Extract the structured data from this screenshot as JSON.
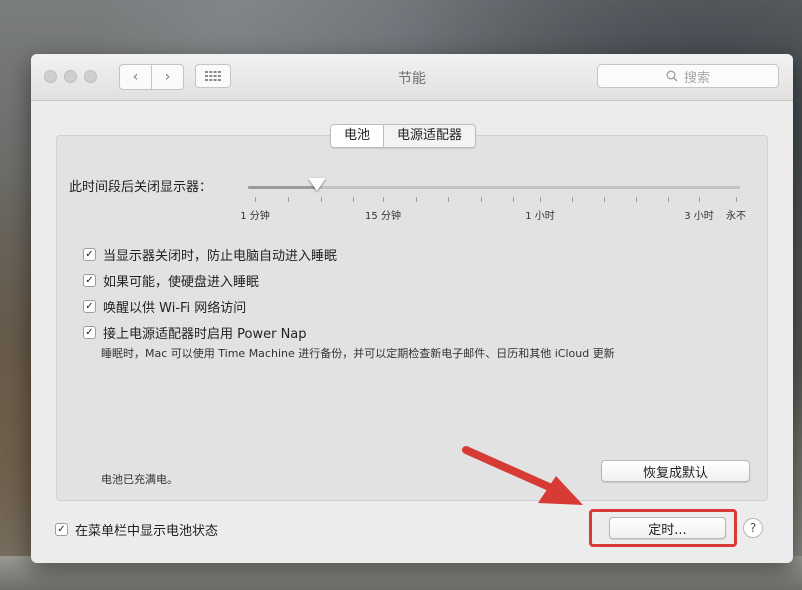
{
  "window": {
    "title": "节能"
  },
  "toolbar": {
    "back_glyph": "‹",
    "forward_glyph": "›",
    "search_placeholder": "搜索",
    "search_icon": "magnifier-icon"
  },
  "tabs": [
    {
      "label": "电池",
      "active": true
    },
    {
      "label": "电源适配器",
      "active": false
    }
  ],
  "display_sleep": {
    "label": "此时间段后关闭显示器：",
    "ticks": [
      "1 分钟",
      "15 分钟",
      "1 小时",
      "3 小时",
      "永不"
    ],
    "value": "2 分钟",
    "value_fraction": 0.14
  },
  "options": [
    {
      "label": "当显示器关闭时，防止电脑自动进入睡眠",
      "checked": true
    },
    {
      "label": "如果可能，使硬盘进入睡眠",
      "checked": true
    },
    {
      "label": "唤醒以供 Wi-Fi 网络访问",
      "checked": true
    },
    {
      "label": "接上电源适配器时启用 Power Nap",
      "checked": true
    }
  ],
  "power_nap_note": "睡眠时，Mac 可以使用 Time Machine 进行备份，并可以定期检查新电子邮件、日历和其他 iCloud 更新",
  "battery_status": "电池已充满电。",
  "restore_defaults_label": "恢复成默认",
  "show_in_menubar": {
    "label": "在菜单栏中显示电池状态",
    "checked": true
  },
  "schedule_label": "定时...",
  "help_glyph": "?",
  "check_glyph": "✓",
  "colors": {
    "annotation_red": "#d83a35"
  }
}
